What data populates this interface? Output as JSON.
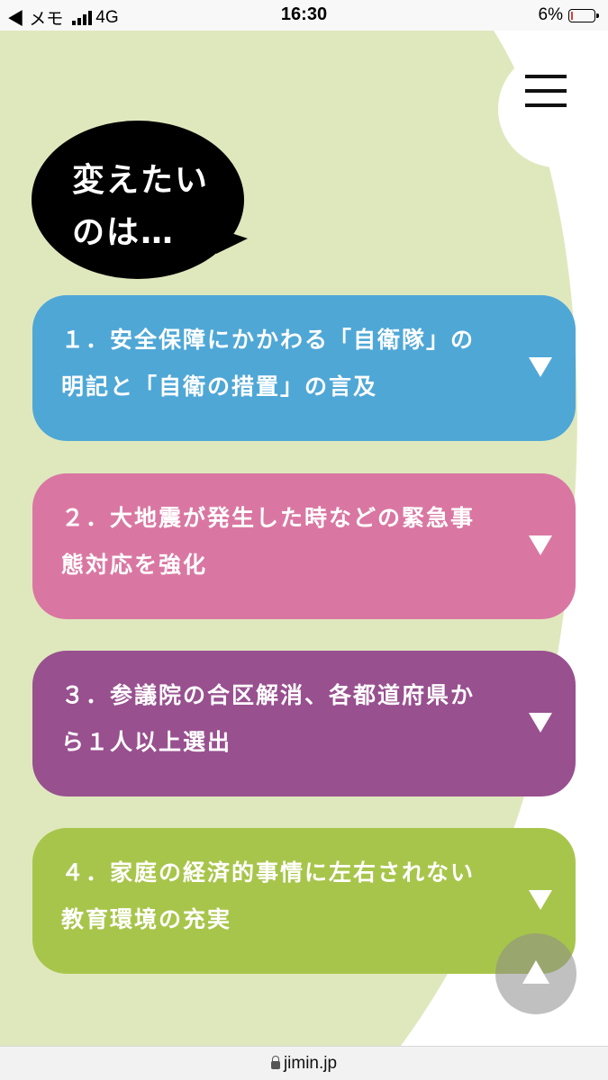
{
  "status_bar": {
    "back_label": "◀ メモ",
    "network": "4G",
    "time": "16:30",
    "battery": "6%"
  },
  "header": {
    "bubble_line1": "変えたい",
    "bubble_line2": "のは…"
  },
  "items": [
    {
      "label": "１．安全保障にかかわる「自衛隊」の明記と「自衛の措置」の言及",
      "color": "#4fa7d6"
    },
    {
      "label": "２．大地震が発生した時などの緊急事態対応を強化",
      "color": "#d977a2"
    },
    {
      "label": "３．参議院の合区解消、各都道府県から１人以上選出",
      "color": "#98508f"
    },
    {
      "label": "４．家庭の経済的事情に左右されない教育環境の充実",
      "color": "#a8c54b"
    }
  ],
  "url_bar": {
    "domain": "jimin.jp"
  },
  "colors": {
    "background_green": "#dfe8bd",
    "bubble": "#000000"
  }
}
